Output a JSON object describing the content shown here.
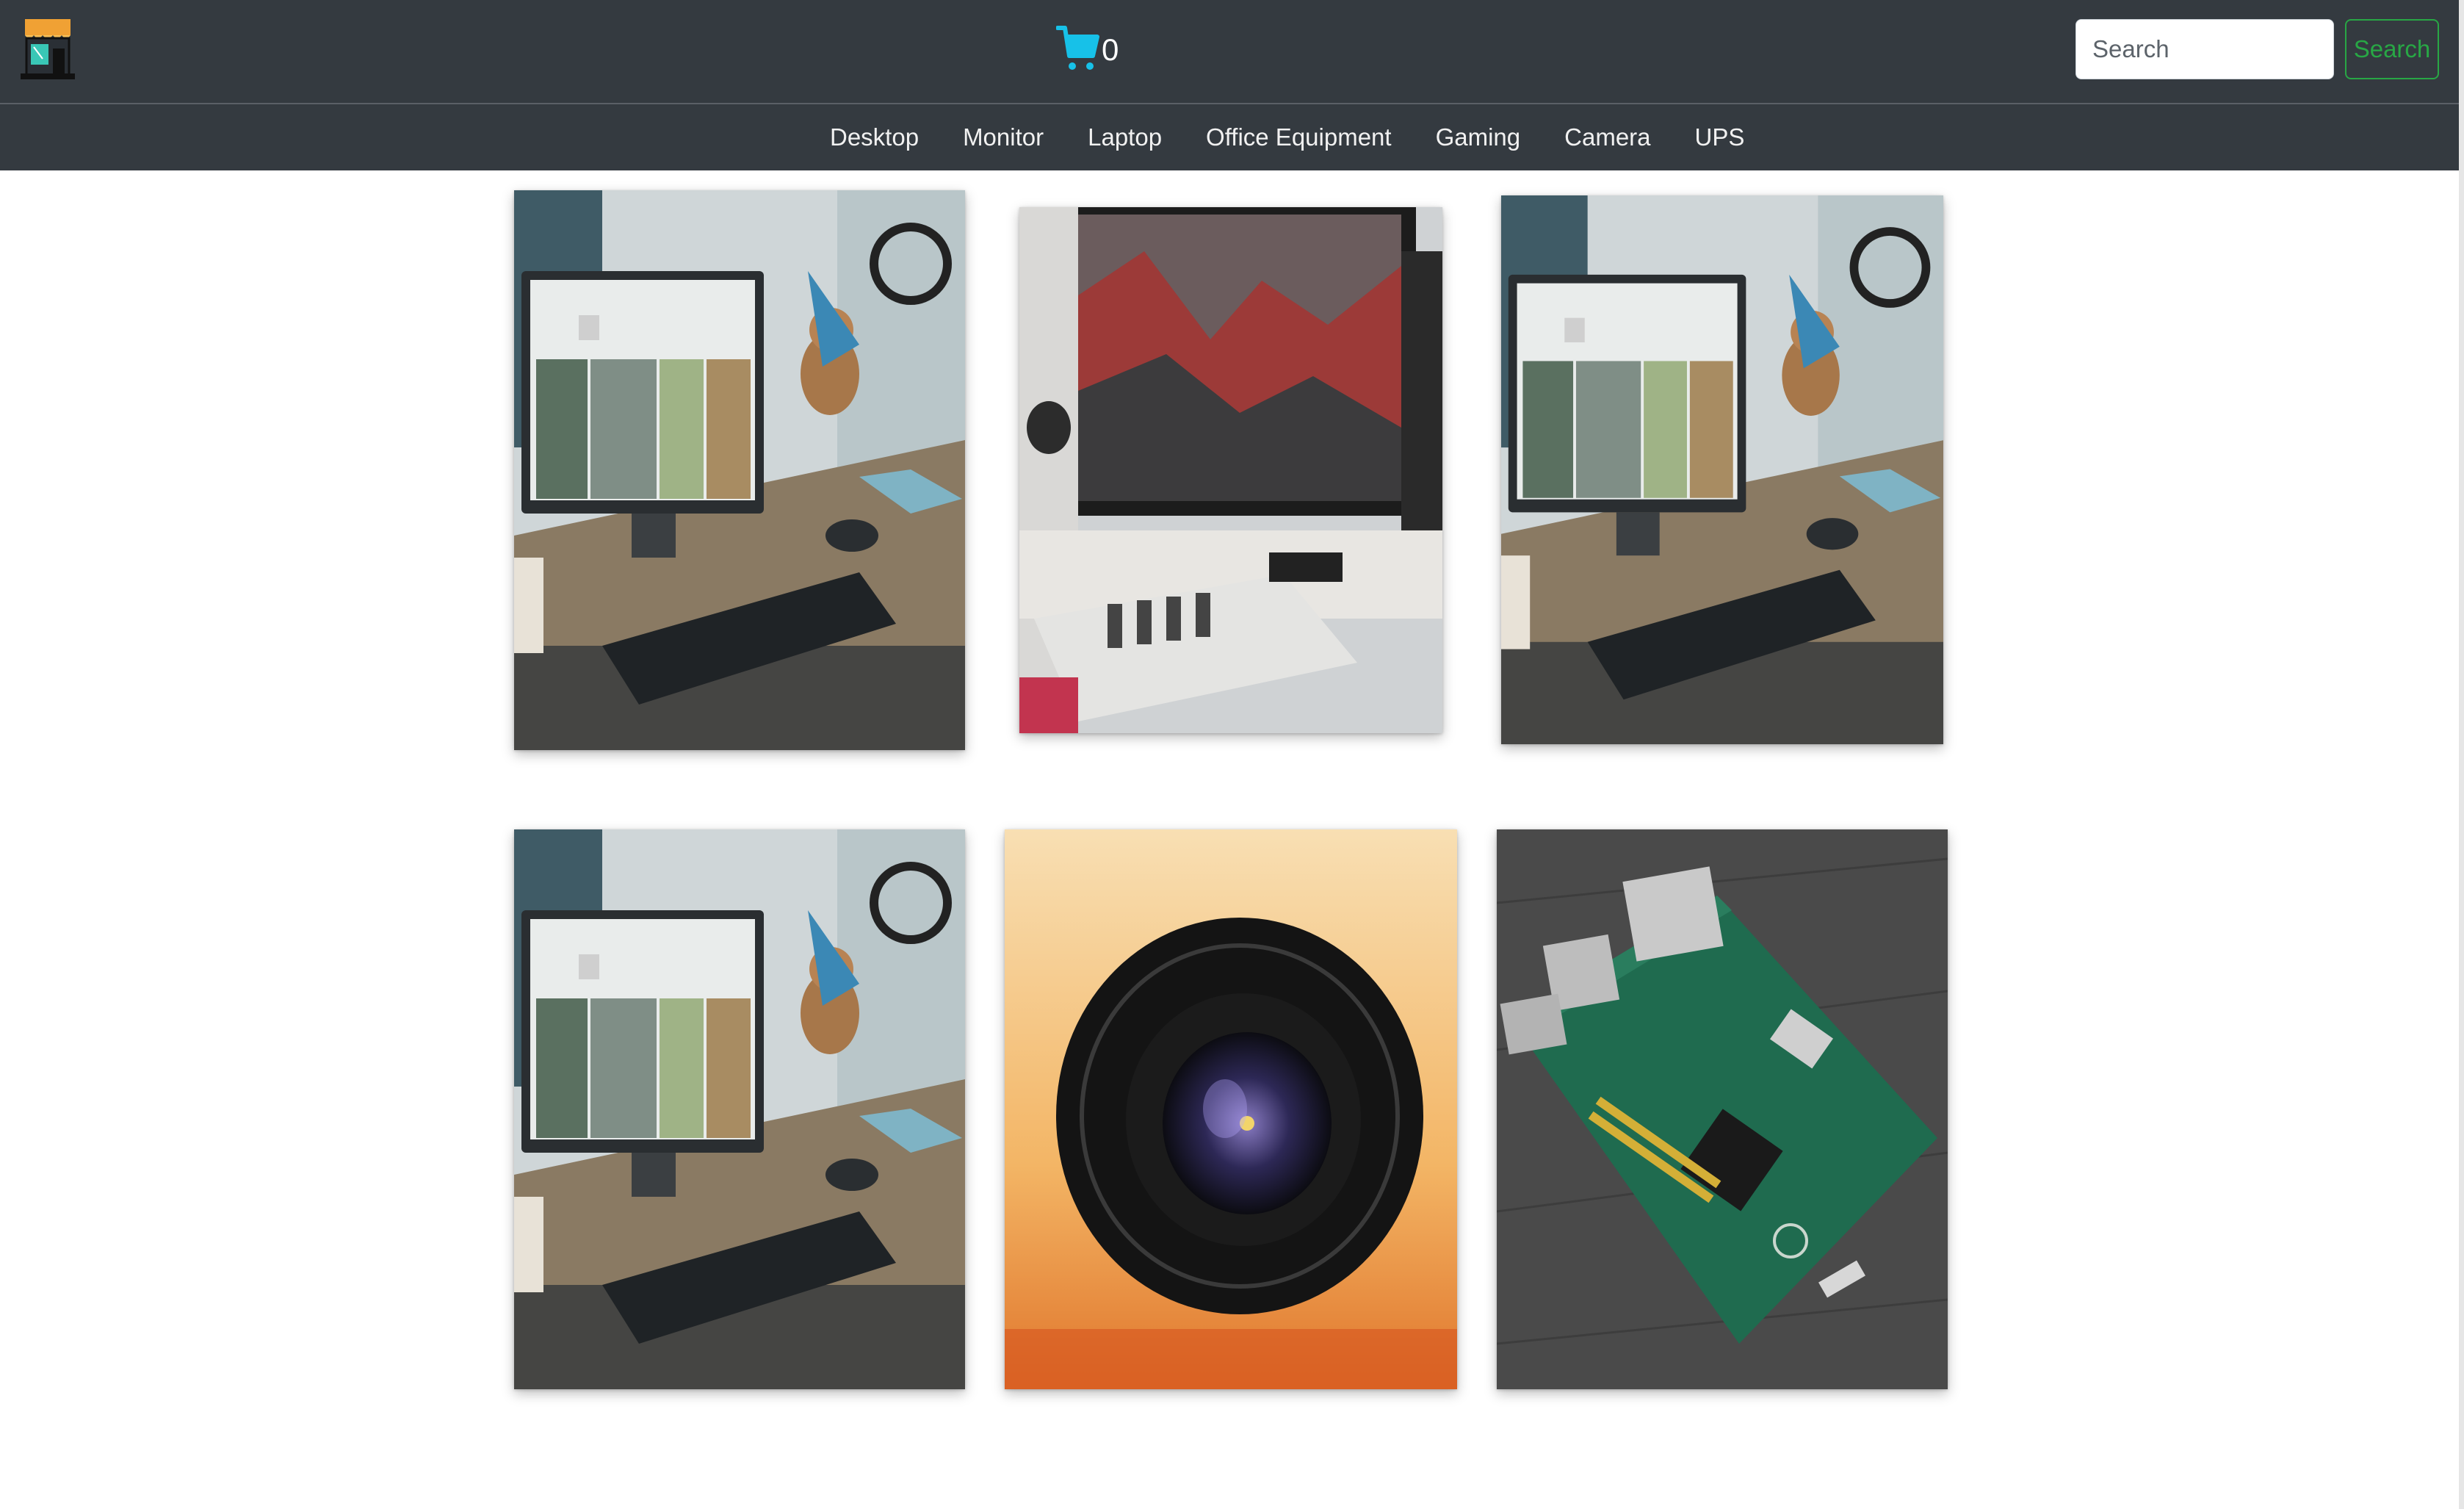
{
  "header": {
    "logo_icon": "storefront-icon",
    "cart_icon": "shopping-cart-icon",
    "cart_count": "0",
    "search_placeholder": "Search",
    "search_button_label": "Search",
    "cart_color": "#17c1e8",
    "search_button_color": "#28a745"
  },
  "categories": [
    {
      "label": "Desktop"
    },
    {
      "label": "Monitor"
    },
    {
      "label": "Laptop"
    },
    {
      "label": "Office Equipment"
    },
    {
      "label": "Gaming"
    },
    {
      "label": "Camera"
    },
    {
      "label": "UPS"
    }
  ],
  "products": [
    {
      "image": "desk-setup-photo"
    },
    {
      "image": "monitor-studio-photo"
    },
    {
      "image": "desk-setup-photo"
    },
    {
      "image": "desk-setup-photo"
    },
    {
      "image": "camera-lens-photo"
    },
    {
      "image": "circuit-board-photo"
    }
  ]
}
